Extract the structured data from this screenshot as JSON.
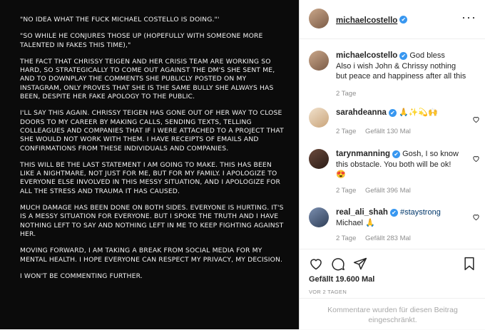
{
  "post": {
    "paragraphs": [
      "\"No idea what the fuck Michael Costello is doing.\"'",
      "\"So while he conjures those up (hopefully with someone more talented in fakes this time),\"",
      "The fact that Chrissy Teigen and her crisis team are working so hard, so strategically to come out against the DM's she sent me, and to downplay the comments she publicly posted on my Instagram, only proves that she is the same bully she always has been, despite her fake apology to the public.",
      "I'll say this again. Chrissy Teigen has gone out of her way to close doors to my career by making calls, sending texts, telling colleagues and companies that if I were attached to a project that she would not work with them. I have receipts of emails and confirmations from these individuals and companies.",
      "This will be the last statement I am going to make. This has been like a nightmare, not just for me, but for my family. I apologize to everyone else involved in this messy situation, and I apologize for all the stress and trauma it has caused.",
      "Much damage has been done on both sides. Everyone is hurting. It's is a messy situation for everyone. But I spoke the truth and I have nothing left to say and nothing left in me to keep fighting against her.",
      "Moving forward, I am taking a break from social media for my mental health. I hope everyone can respect my privacy, my decision.",
      "I won't be commenting further."
    ]
  },
  "header": {
    "username": "michaelcostello",
    "verified_glyph": "✔",
    "more_glyph": "···"
  },
  "caption": {
    "username": "michaelcostello",
    "text": "God bless\nAlso i wish John & Chrissy nothing but peace and happiness after all this",
    "time": "2 Tage"
  },
  "comments": [
    {
      "username": "sarahdeanna",
      "text": "🙏✨💫🙌",
      "time": "2 Tage",
      "likes": "Gefällt 130 Mal"
    },
    {
      "username": "tarynmanning",
      "text": "Gosh, I so know this obstacle. You both will be ok!\n😍",
      "time": "2 Tage",
      "likes": "Gefällt 396 Mal"
    },
    {
      "username": "real_ali_shah",
      "hashtag": "#staystrong",
      "text": "Michael 🙏",
      "time": "2 Tage",
      "likes": "Gefällt 283 Mal"
    }
  ],
  "likes": "Gefällt 19.600 Mal",
  "date": "VOR 2 TAGEN",
  "comments_disabled": "Kommentare wurden für diesen Beitrag eingeschränkt."
}
